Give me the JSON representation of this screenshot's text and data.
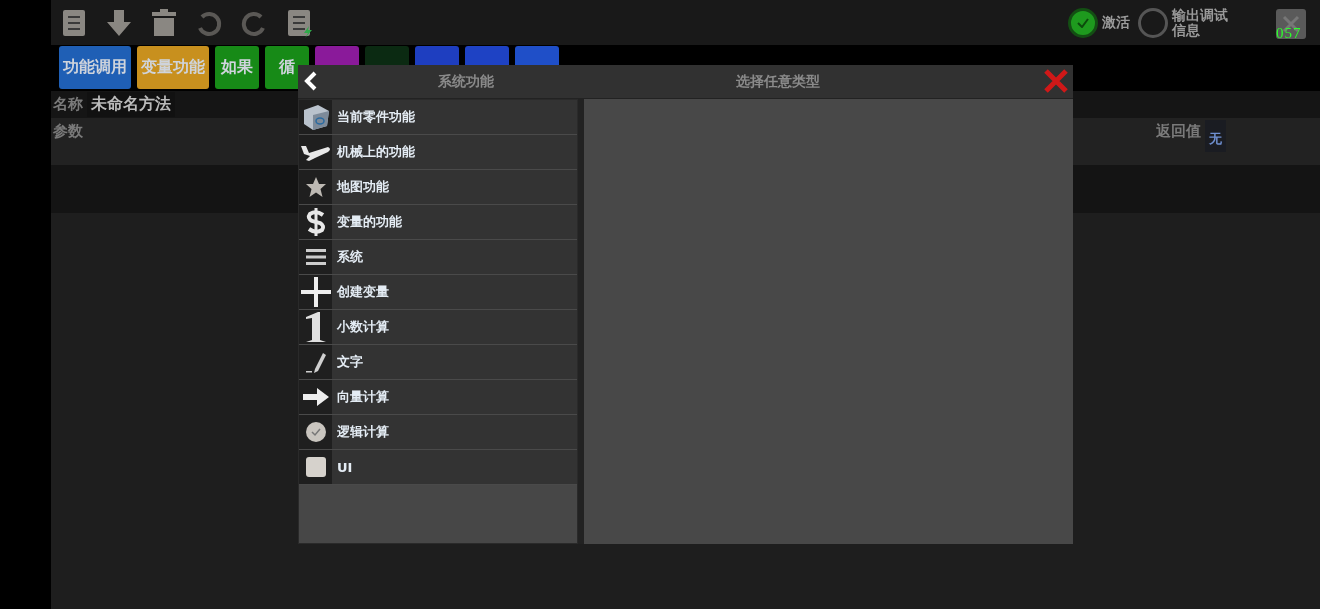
{
  "toolbar": [
    {
      "kind": "list"
    },
    {
      "kind": "download"
    },
    {
      "kind": "trash"
    },
    {
      "kind": "undo"
    },
    {
      "kind": "redo"
    },
    {
      "kind": "list-bolt"
    }
  ],
  "status": {
    "active_label": "激活",
    "active": true,
    "debug_label": "输出调试信息",
    "debug": false,
    "fps": "057"
  },
  "tabs": [
    {
      "label": "功能调用",
      "color": "#1f5fb5"
    },
    {
      "label": "变量功能",
      "color": "#c8901e"
    },
    {
      "label": "如果",
      "color": "#178a17"
    },
    {
      "label": "循",
      "color": "#178a17"
    },
    {
      "color": "#8a1a9a"
    },
    {
      "color": "#0b2a12"
    },
    {
      "color": "#1e3ec0"
    },
    {
      "color": "#1e42c4"
    },
    {
      "color": "#1f4fc8"
    }
  ],
  "method": {
    "name_label": "名称",
    "name": "未命名方法",
    "params_label": "参数",
    "return_label": "返回值",
    "return_value": "无"
  },
  "dialog": {
    "left_title": "系统功能",
    "right_title": "选择任意类型",
    "items": [
      {
        "kind": "part",
        "label": "当前零件功能"
      },
      {
        "kind": "plane",
        "label": "机械上的功能"
      },
      {
        "kind": "star",
        "label": "地图功能"
      },
      {
        "kind": "dollar",
        "label": "变量的功能"
      },
      {
        "kind": "menu",
        "label": "系统"
      },
      {
        "kind": "plus",
        "label": "创建变量"
      },
      {
        "kind": "one",
        "label": "小数计算"
      },
      {
        "kind": "pencil",
        "label": "文字"
      },
      {
        "kind": "arrow",
        "label": "向量计算"
      },
      {
        "kind": "check",
        "label": "逻辑计算"
      },
      {
        "kind": "square",
        "label": "UI"
      }
    ]
  }
}
